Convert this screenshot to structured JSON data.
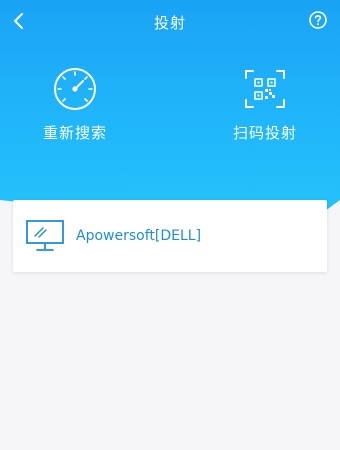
{
  "header": {
    "title": "投射",
    "back_icon": "chevron-left-icon",
    "help_icon": "question-circle-icon"
  },
  "actions": [
    {
      "label": "重新搜索",
      "icon": "speedometer-icon"
    },
    {
      "label": "扫码投射",
      "icon": "qr-scan-icon"
    }
  ],
  "devices": [
    {
      "name": "Apowersoft[DELL]",
      "icon": "monitor-icon"
    }
  ],
  "colors": {
    "header_blue": "#1aa3f5",
    "device_text": "#1d8fd8",
    "background": "#f6f6f8"
  }
}
